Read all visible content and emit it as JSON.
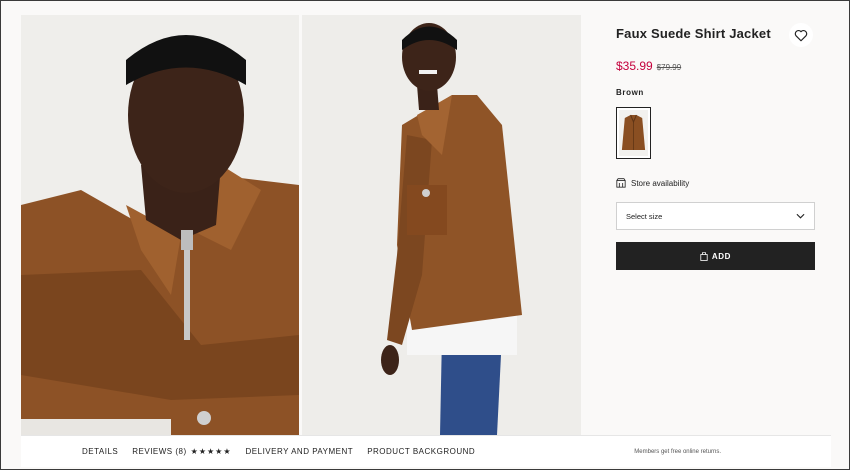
{
  "product": {
    "title": "Faux Suede Shirt Jacket",
    "price": "$35.99",
    "old_price": "$79.99",
    "color_name": "Brown",
    "store_availability": "Store availability",
    "size_placeholder": "Select size",
    "add_label": "ADD"
  },
  "bottom_bar": {
    "details": "DETAILS",
    "reviews": "REVIEWS (8)",
    "review_stars": "★★★★★",
    "rating": 5,
    "delivery": "DELIVERY AND PAYMENT",
    "background": "PRODUCT BACKGROUND",
    "returns_note": "Members get free online returns."
  },
  "colors": {
    "price": "#c4003c",
    "jacket": "#8a4f22",
    "button": "#222222"
  },
  "icons": {
    "favorite": "heart-icon",
    "store": "store-icon",
    "dropdown": "chevron-down-icon",
    "add": "shopping-bag-icon"
  }
}
